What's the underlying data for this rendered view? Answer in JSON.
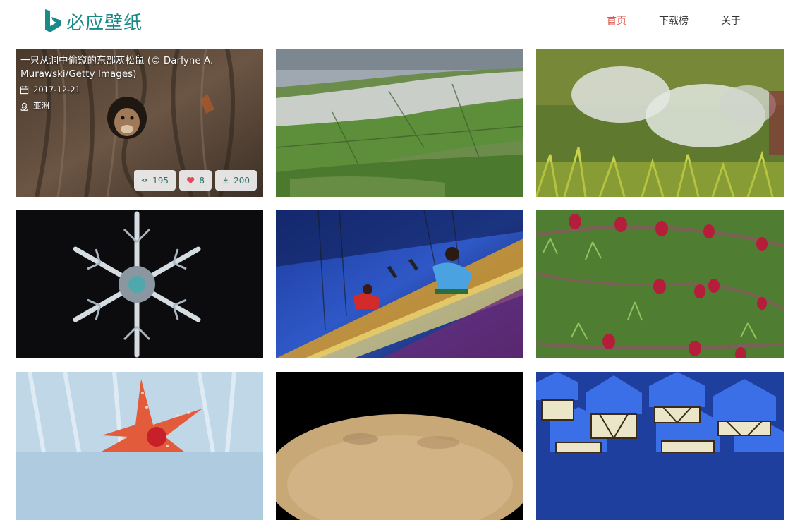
{
  "brand": {
    "name": "必应壁纸",
    "color": "#1a8a86"
  },
  "nav": {
    "items": [
      {
        "label": "首页",
        "active": true
      },
      {
        "label": "下载榜",
        "active": false
      },
      {
        "label": "关于",
        "active": false
      }
    ],
    "active_color": "#e0574f"
  },
  "cards": [
    {
      "title": "一只从洞中偷窥的东部灰松鼠 (© Darlyne A. Murawski/Getty Images)",
      "date": "2017-12-21",
      "region": "亚洲",
      "views": "195",
      "likes": "8",
      "downloads": "200",
      "icons": [
        "calendar-icon",
        "location-icon",
        "eye-icon",
        "heart-icon",
        "download-icon"
      ]
    }
  ]
}
